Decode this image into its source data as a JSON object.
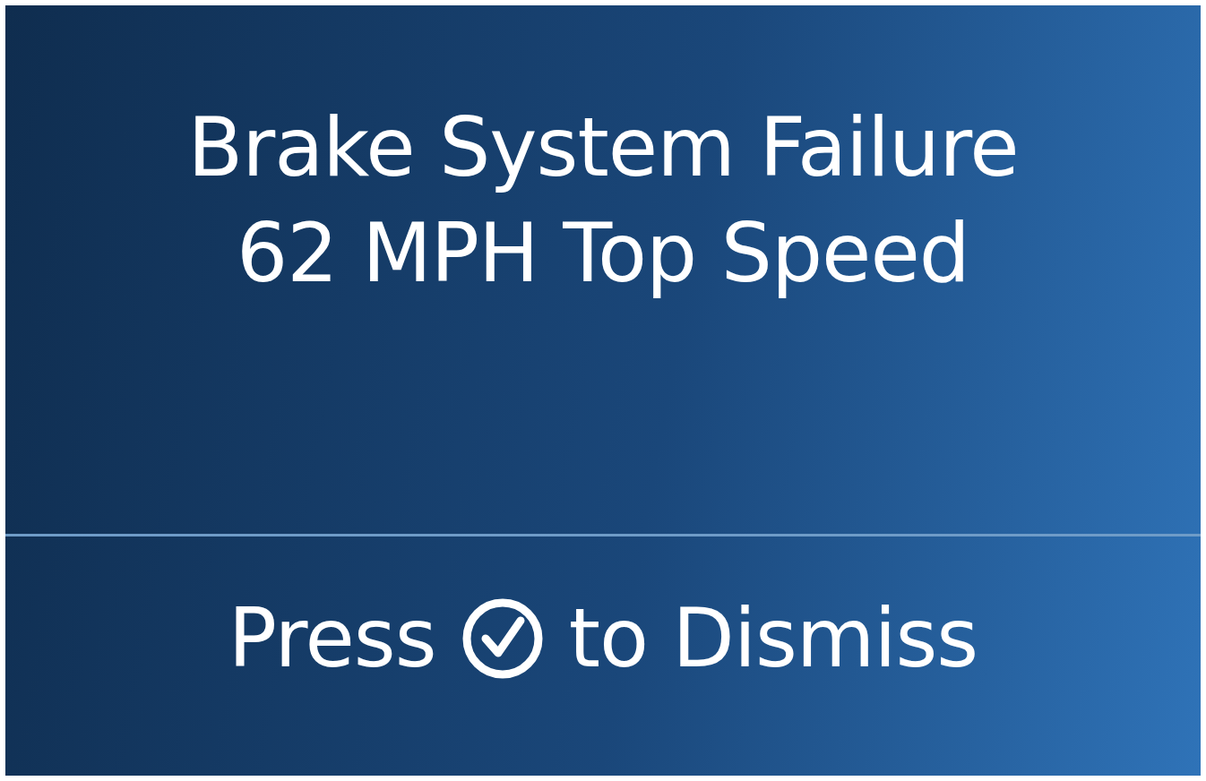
{
  "message": {
    "lines": [
      "Brake System Failure",
      "62 MPH Top Speed"
    ]
  },
  "dismiss": {
    "before": "Press",
    "after": "to Dismiss"
  }
}
